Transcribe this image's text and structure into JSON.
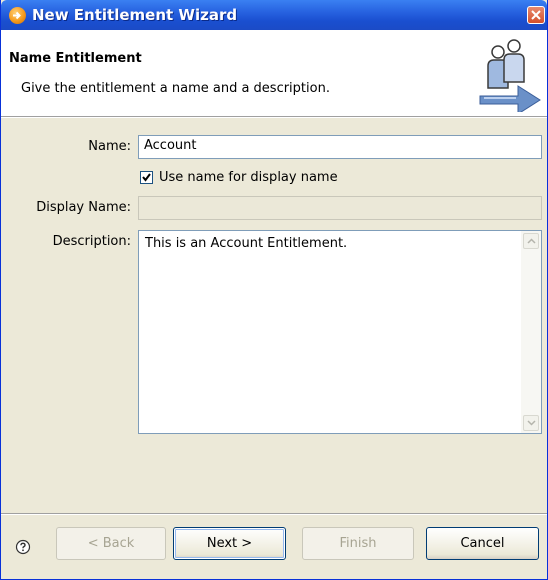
{
  "window": {
    "title": "New Entitlement Wizard"
  },
  "header": {
    "title": "Name Entitlement",
    "description": "Give the entitlement a name and a description."
  },
  "form": {
    "name_label": "Name:",
    "name_value": "Account",
    "use_name_checkbox_label": "Use name for display name",
    "use_name_checked": true,
    "display_name_label": "Display Name:",
    "display_name_value": "",
    "description_label": "Description:",
    "description_value": "This is an Account Entitlement."
  },
  "buttons": {
    "back": "< Back",
    "next": "Next >",
    "finish": "Finish",
    "cancel": "Cancel"
  },
  "icons": {
    "title": "wizard-app-icon",
    "close": "close-icon",
    "header_art": "users-entitlement-icon",
    "help": "help-icon",
    "check": "check-icon",
    "scroll_up": "chevron-up-icon",
    "scroll_down": "chevron-down-icon"
  },
  "colors": {
    "titlebar": "#2762e0",
    "dialog_bg": "#ece9d8",
    "header_bg": "#ffffff",
    "field_border": "#7f9db9"
  }
}
